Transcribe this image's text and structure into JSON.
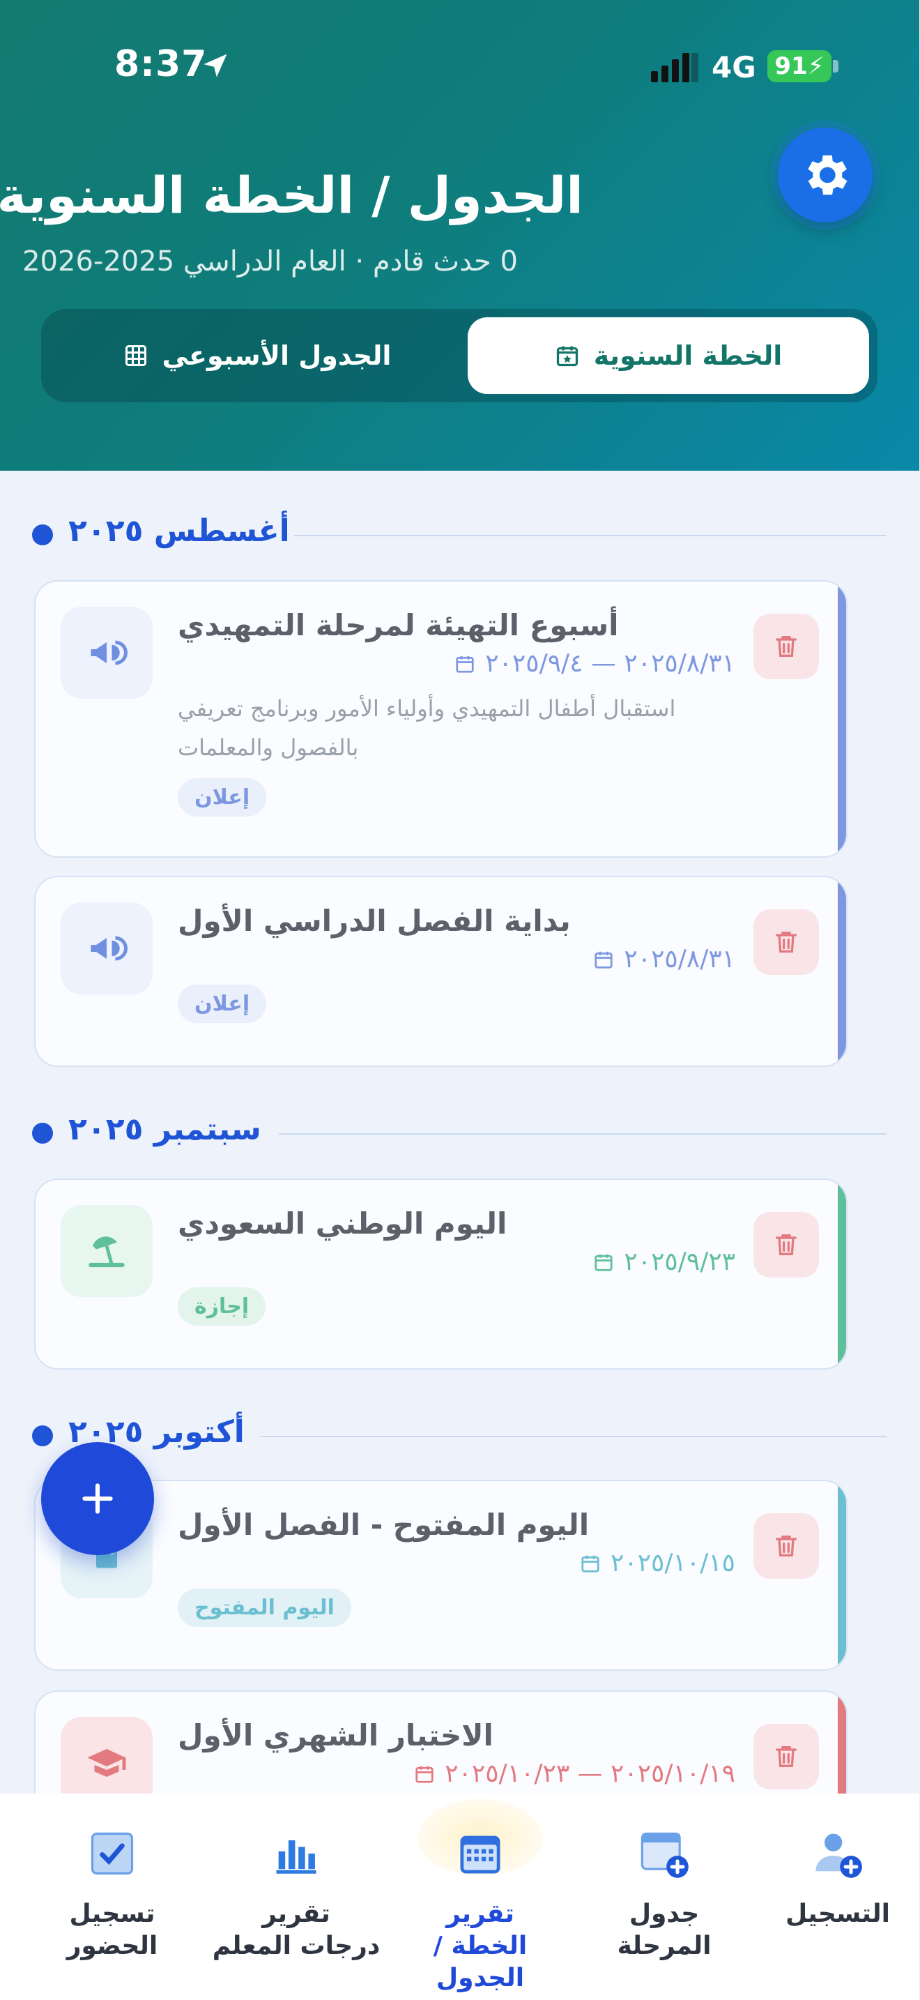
{
  "status_bar": {
    "time": "8:37",
    "network": "4G",
    "battery": "91"
  },
  "header": {
    "title": "الجدول / الخطة السنوية",
    "subtitle": "0 حدث قادم · العام الدراسي 2025-2026"
  },
  "tabs": [
    {
      "label": "الخطة السنوية",
      "active": true
    },
    {
      "label": "الجدول الأسبوعي",
      "active": false
    }
  ],
  "months": [
    {
      "label": "أغسطس ٢٠٢٥"
    },
    {
      "label": "سبتمبر ٢٠٢٥"
    },
    {
      "label": "أكتوبر ٢٠٢٥"
    }
  ],
  "events": [
    {
      "title": "أسبوع التهيئة لمرحلة التمهيدي",
      "date": "٢٠٢٥/٨/٣١ — ٢٠٢٥/٩/٤",
      "description": "استقبال أطفال التمهيدي وأولياء الأمور وبرنامج تعريفي بالفصول والمعلمات",
      "tag": "إعلان",
      "icon": "megaphone-icon",
      "accent": "#7d98e0"
    },
    {
      "title": "بداية الفصل الدراسي الأول",
      "date": "٢٠٢٥/٨/٣١",
      "tag": "إعلان",
      "icon": "megaphone-icon",
      "accent": "#7d98e0"
    },
    {
      "title": "اليوم الوطني السعودي",
      "date": "٢٠٢٥/٩/٢٣",
      "tag": "إجازة",
      "icon": "beach-umbrella-icon",
      "accent": "#5fbf9a"
    },
    {
      "title": "اليوم المفتوح - الفصل الأول",
      "date": "٢٠٢٥/١٠/١٥",
      "tag": "اليوم المفتوح",
      "icon": "door-icon",
      "accent": "#6bbfd0"
    },
    {
      "title": "الاختبار الشهري الأول",
      "date": "٢٠٢٥/١٠/١٩ — ٢٠٢٥/١٠/٢٣",
      "icon": "graduation-cap-icon",
      "accent": "#e27a80"
    }
  ],
  "bottom_nav": [
    {
      "label": "تسجيل\nالحضور",
      "icon": "checkbox-icon"
    },
    {
      "label": "تقرير\nدرجات المعلم",
      "icon": "bar-chart-icon"
    },
    {
      "label": "تقرير\nالخطة / الجدول",
      "icon": "calendar-grid-icon",
      "active": true
    },
    {
      "label": "جدول\nالمرحلة",
      "icon": "calendar-add-icon"
    },
    {
      "label": "التسجيل",
      "icon": "user-add-icon"
    }
  ]
}
